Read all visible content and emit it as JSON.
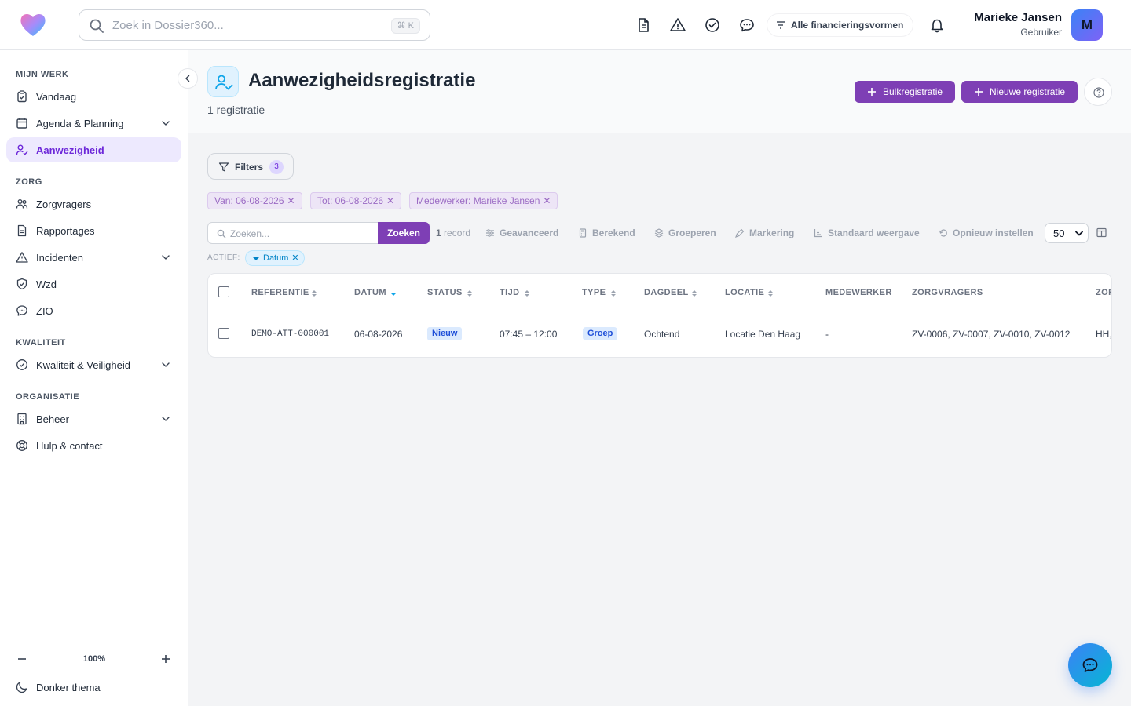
{
  "search": {
    "placeholder": "Zoek in Dossier360...",
    "shortcut": "⌘ K"
  },
  "topbar": {
    "icons": [
      "document-icon",
      "warning-icon",
      "check-circle-icon",
      "chat-icon",
      "bell-icon"
    ],
    "financing": "Alle financieringsvormen",
    "user_name": "Marieke Jansen",
    "user_role": "Gebruiker",
    "avatar_letter": "M"
  },
  "sidebar": {
    "sections": {
      "mijn_werk": "MIJN WERK",
      "zorg": "ZORG",
      "kwaliteit": "KWALITEIT",
      "organisatie": "ORGANISATIE"
    },
    "items": {
      "vandaag": "Vandaag",
      "agenda": "Agenda & Planning",
      "aanwezigheid": "Aanwezigheid",
      "zorgvragers": "Zorgvragers",
      "rapportages": "Rapportages",
      "incidenten": "Incidenten",
      "wzd": "Wzd",
      "zio": "ZIO",
      "kwaliteit": "Kwaliteit & Veiligheid",
      "beheer": "Beheer",
      "hulp": "Hulp & contact"
    },
    "active_item": "Aanwezigheid",
    "zoom": "100%",
    "theme": "Donker thema"
  },
  "page": {
    "title": "Aanwezigheidsregistratie",
    "subtitle": "1 registratie",
    "bulk_button": "Bulkregistratie",
    "new_button": "Nieuwe registratie"
  },
  "filters": {
    "label": "Filters",
    "count": "3",
    "chips": [
      "Van: 06-08-2026",
      "Tot: 06-08-2026",
      "Medewerker: Marieke Jansen"
    ]
  },
  "toolbar": {
    "search_placeholder": "Zoeken...",
    "search_button": "Zoeken",
    "record_count": "1",
    "record_label": "record",
    "advanced": "Geavanceerd",
    "computed": "Berekend",
    "group": "Groeperen",
    "marking": "Markering",
    "default_view": "Standaard weergave",
    "reset": "Opnieuw instellen",
    "per_page": "50",
    "active_label": "ACTIEF:",
    "active_sort": "Datum"
  },
  "table": {
    "columns": [
      "REFERENTIE",
      "DATUM",
      "STATUS",
      "TIJD",
      "TYPE",
      "DAGDEEL",
      "LOCATIE",
      "MEDEWERKER",
      "ZORGVRAGERS",
      "ZOR"
    ],
    "rows": [
      {
        "referentie": "DEMO-ATT-000001",
        "datum": "06-08-2026",
        "status": "Nieuw",
        "tijd": "07:45 – 12:00",
        "type": "Groep",
        "dagdeel": "Ochtend",
        "locatie": "Locatie Den Haag",
        "medewerker": "-",
        "zorgvragers": "ZV-0006, ZV-0007, ZV-0010, ZV-0012",
        "zor": "HH,"
      }
    ]
  },
  "colors": {
    "accent": "#7e3fb5",
    "active_bg": "#ede9fe",
    "sort_chip": "#0284c7"
  }
}
